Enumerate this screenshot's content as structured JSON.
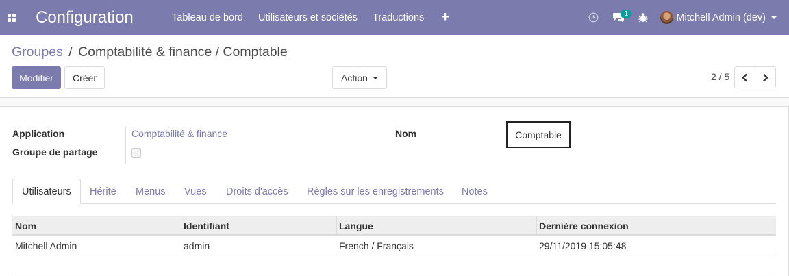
{
  "navbar": {
    "app_title": "Configuration",
    "menu": [
      "Tableau de bord",
      "Utilisateurs et sociétés",
      "Traductions"
    ],
    "message_badge": "1",
    "user_name": "Mitchell Admin (dev)",
    "color": "#7c7bad"
  },
  "breadcrumb": {
    "parent": "Groupes",
    "separator": "/",
    "current": "Comptabilité & finance / Comptable"
  },
  "buttons": {
    "edit": "Modifier",
    "create": "Créer",
    "action": "Action"
  },
  "pager": {
    "value": "2 / 5"
  },
  "form": {
    "application_label": "Application",
    "application_value": "Comptabilité & finance",
    "share_label": "Groupe de partage",
    "share_checked": false,
    "name_label": "Nom",
    "name_value": "Comptable"
  },
  "tabs": [
    "Utilisateurs",
    "Hérité",
    "Menus",
    "Vues",
    "Droits d'accès",
    "Règles sur les enregistrements",
    "Notes"
  ],
  "table": {
    "columns": [
      "Nom",
      "Identifiant",
      "Langue",
      "Dernière connexion"
    ],
    "rows": [
      [
        "Mitchell Admin",
        "admin",
        "French / Français",
        "29/11/2019 15:05:48"
      ]
    ]
  }
}
